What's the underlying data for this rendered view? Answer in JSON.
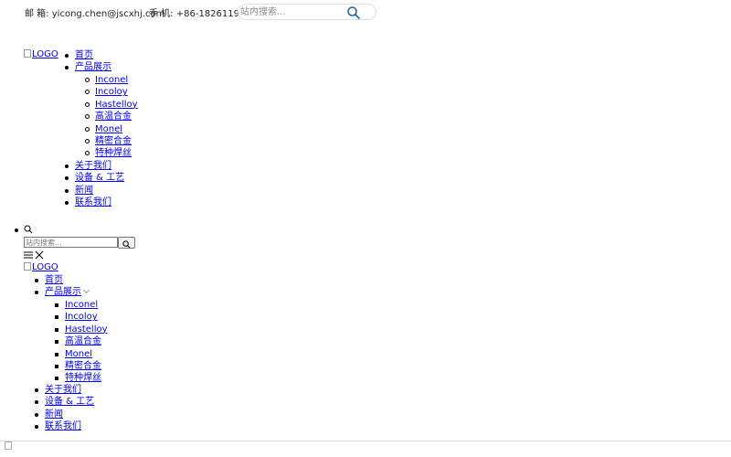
{
  "topbar": {
    "email_label": "邮 箱:",
    "email": "yicong.chen@jscxhj.com",
    "phone_label": "手 机:",
    "phone": "+86-18261191588",
    "search_placeholder": "站内搜索..."
  },
  "logo_alt": "LOGO",
  "menu": {
    "home": "首页",
    "products": "产品展示",
    "product_items": [
      "Inconel",
      "Incoloy",
      "Hastelloy",
      "高温合金",
      "Monel",
      "精密合金",
      "特种焊丝"
    ],
    "about": "关于我们",
    "equipment": "设备 & 工艺",
    "news": "新闻",
    "contact": "联系我们"
  },
  "search2": {
    "placeholder": "站内搜索..."
  },
  "colors": {
    "link": "#0000ee",
    "search_icon": "#1a5fa8"
  },
  "icons": [
    "search-icon",
    "hamburger-icon",
    "close-icon",
    "chevron-down-icon",
    "broken-image-icon"
  ]
}
